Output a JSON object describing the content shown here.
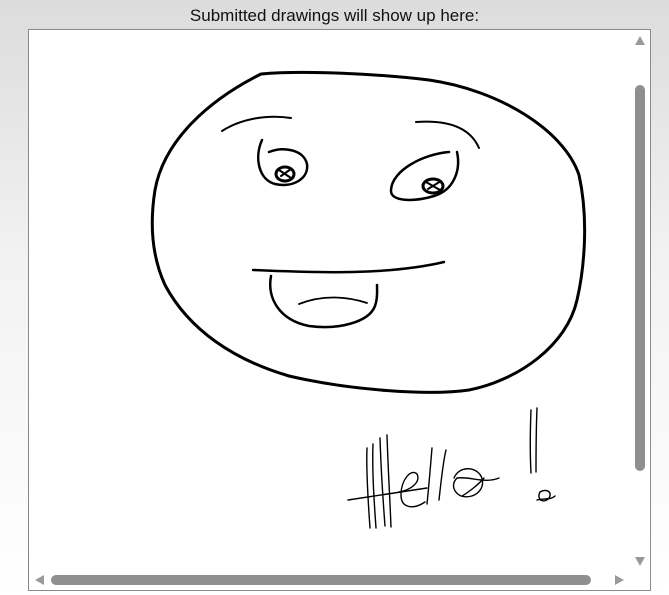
{
  "header": {
    "text": "Submitted drawings will show up here:"
  },
  "colors": {
    "ink": "#000000",
    "panel_background": "#ffffff",
    "scrollbar_thumb": "#8f8f8f",
    "scrollbar_arrow": "#9a9a9a"
  },
  "drawing": {
    "handwritten_text": "Hello!"
  }
}
